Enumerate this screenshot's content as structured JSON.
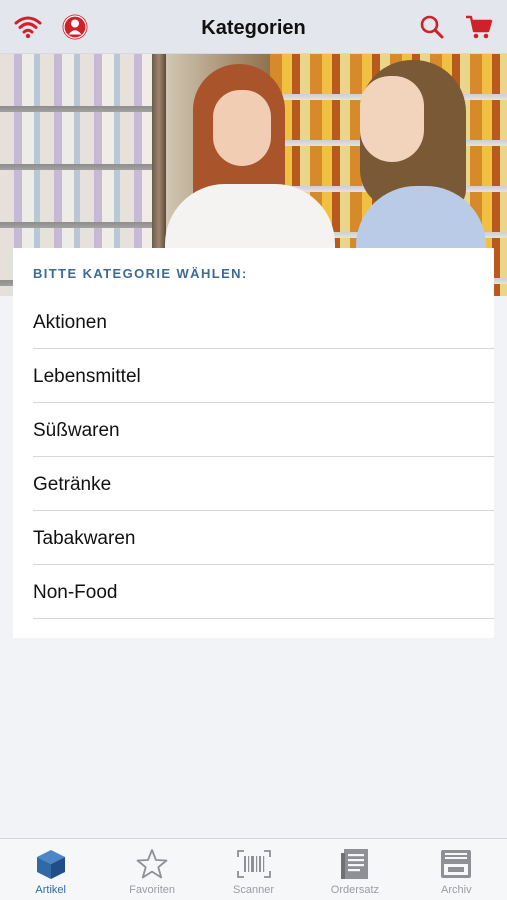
{
  "header": {
    "title": "Kategorien",
    "left_icons": [
      "wifi-icon",
      "user-icon"
    ],
    "right_icons": [
      "search-icon",
      "cart-icon"
    ]
  },
  "colors": {
    "accent_red": "#d0202a",
    "heading_blue": "#3e6a94",
    "tab_active": "#2f6aa6",
    "tab_inactive": "#9a9ca2"
  },
  "categories": {
    "heading": "BITTE KATEGORIE WÄHLEN:",
    "items": [
      {
        "label": "Aktionen"
      },
      {
        "label": "Lebensmittel"
      },
      {
        "label": "Süßwaren"
      },
      {
        "label": "Getränke"
      },
      {
        "label": "Tabakwaren"
      },
      {
        "label": "Non-Food"
      }
    ]
  },
  "tabbar": {
    "active_index": 0,
    "items": [
      {
        "label": "Artikel",
        "icon": "cube-icon"
      },
      {
        "label": "Favoriten",
        "icon": "star-icon"
      },
      {
        "label": "Scanner",
        "icon": "barcode-icon"
      },
      {
        "label": "Ordersatz",
        "icon": "document-icon"
      },
      {
        "label": "Archiv",
        "icon": "archive-icon"
      }
    ]
  }
}
